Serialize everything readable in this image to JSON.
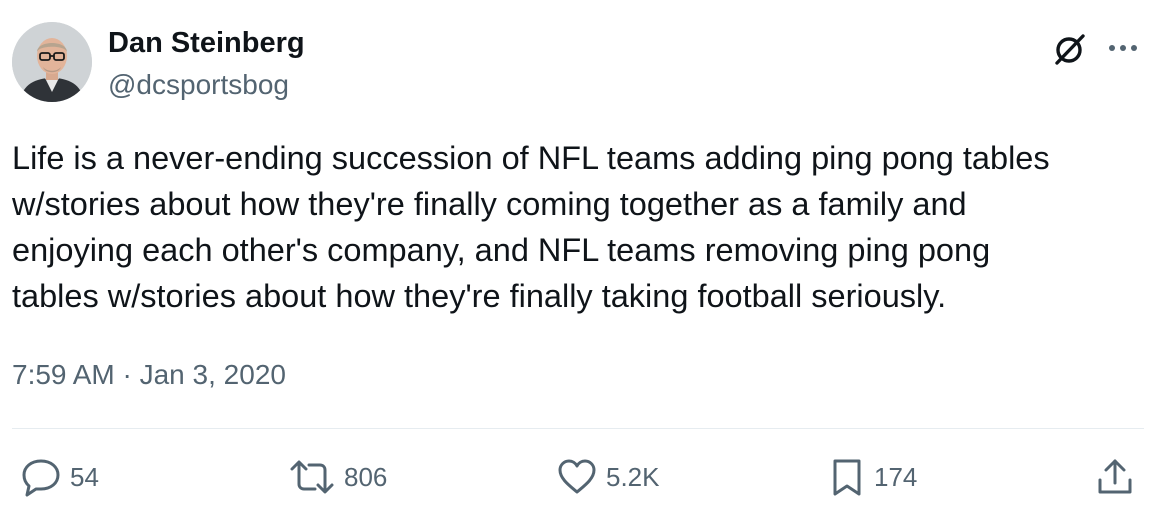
{
  "author": {
    "display_name": "Dan Steinberg",
    "handle": "@dcsportsbog"
  },
  "tweet": {
    "text": "Life is a never-ending succession of NFL teams adding ping pong tables\nw/stories about how they're finally coming together as a family and\nenjoying each other's company, and NFL teams removing ping pong\ntables w/stories about how they're finally taking football seriously.",
    "timestamp": "7:59 AM · Jan 3, 2020"
  },
  "actions": {
    "replies": "54",
    "reposts": "806",
    "likes": "5.2K",
    "bookmarks": "174"
  },
  "icons": {
    "top_right": [
      "grok-icon",
      "more-icon"
    ],
    "action_bar": [
      "reply-icon",
      "repost-icon",
      "like-icon",
      "bookmark-icon",
      "share-icon"
    ]
  },
  "colors": {
    "text_primary": "#0f1419",
    "text_secondary": "#536471",
    "divider": "#e6ecf0"
  }
}
